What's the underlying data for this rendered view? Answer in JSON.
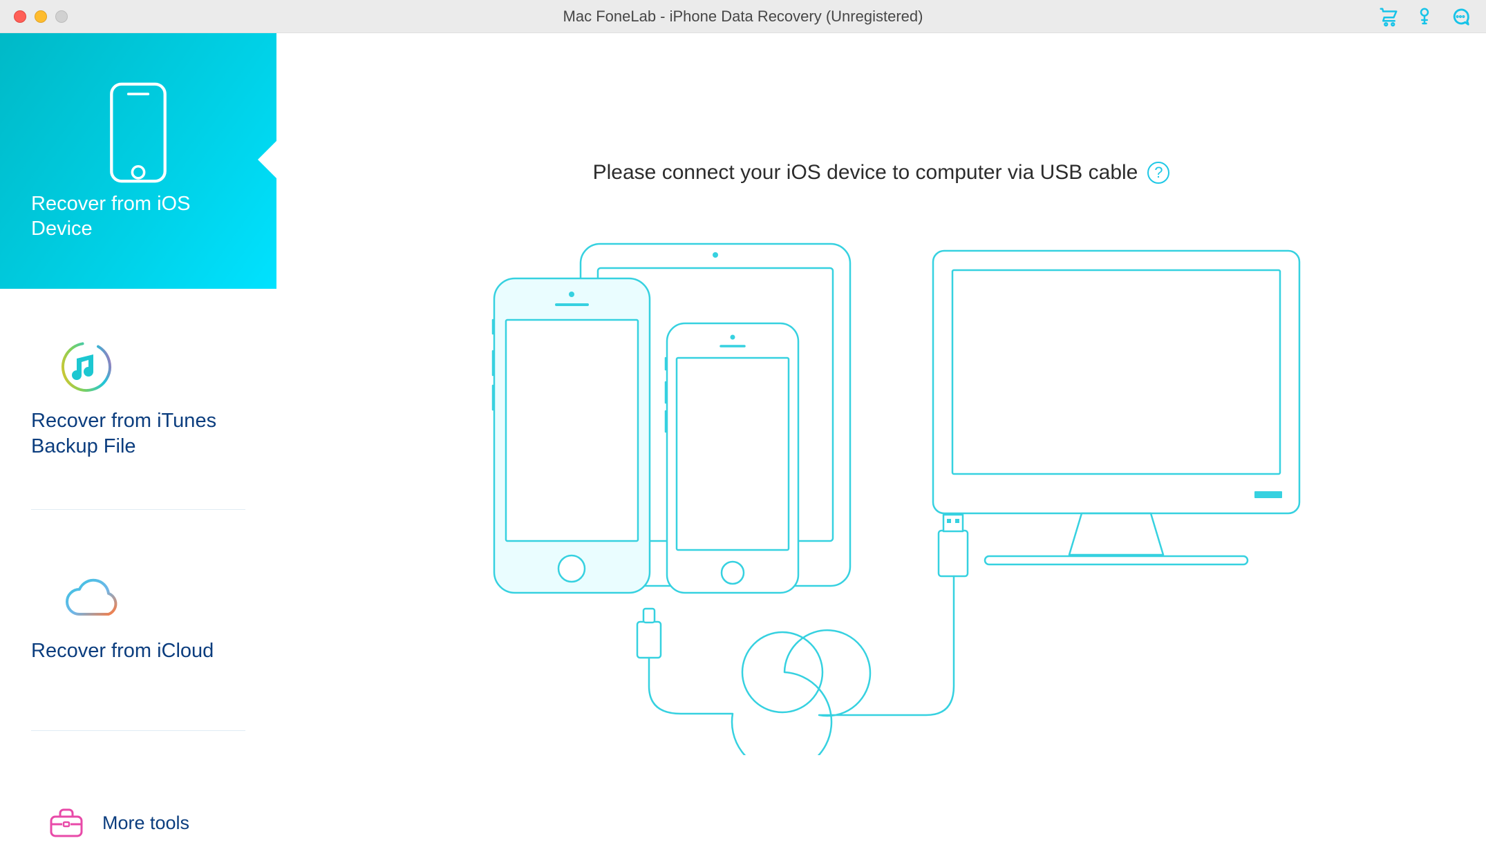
{
  "window": {
    "title": "Mac FoneLab - iPhone Data Recovery (Unregistered)"
  },
  "titlebar_icons": {
    "cart": "cart-icon",
    "key": "key-icon",
    "chat": "chat-icon"
  },
  "sidebar": {
    "items": [
      {
        "label": "Recover from iOS Device",
        "active": true
      },
      {
        "label": "Recover from iTunes Backup File",
        "active": false
      },
      {
        "label": "Recover from iCloud",
        "active": false
      }
    ],
    "more_label": "More tools"
  },
  "main": {
    "heading": "Please connect your iOS device to computer via USB cable",
    "help_symbol": "?"
  }
}
